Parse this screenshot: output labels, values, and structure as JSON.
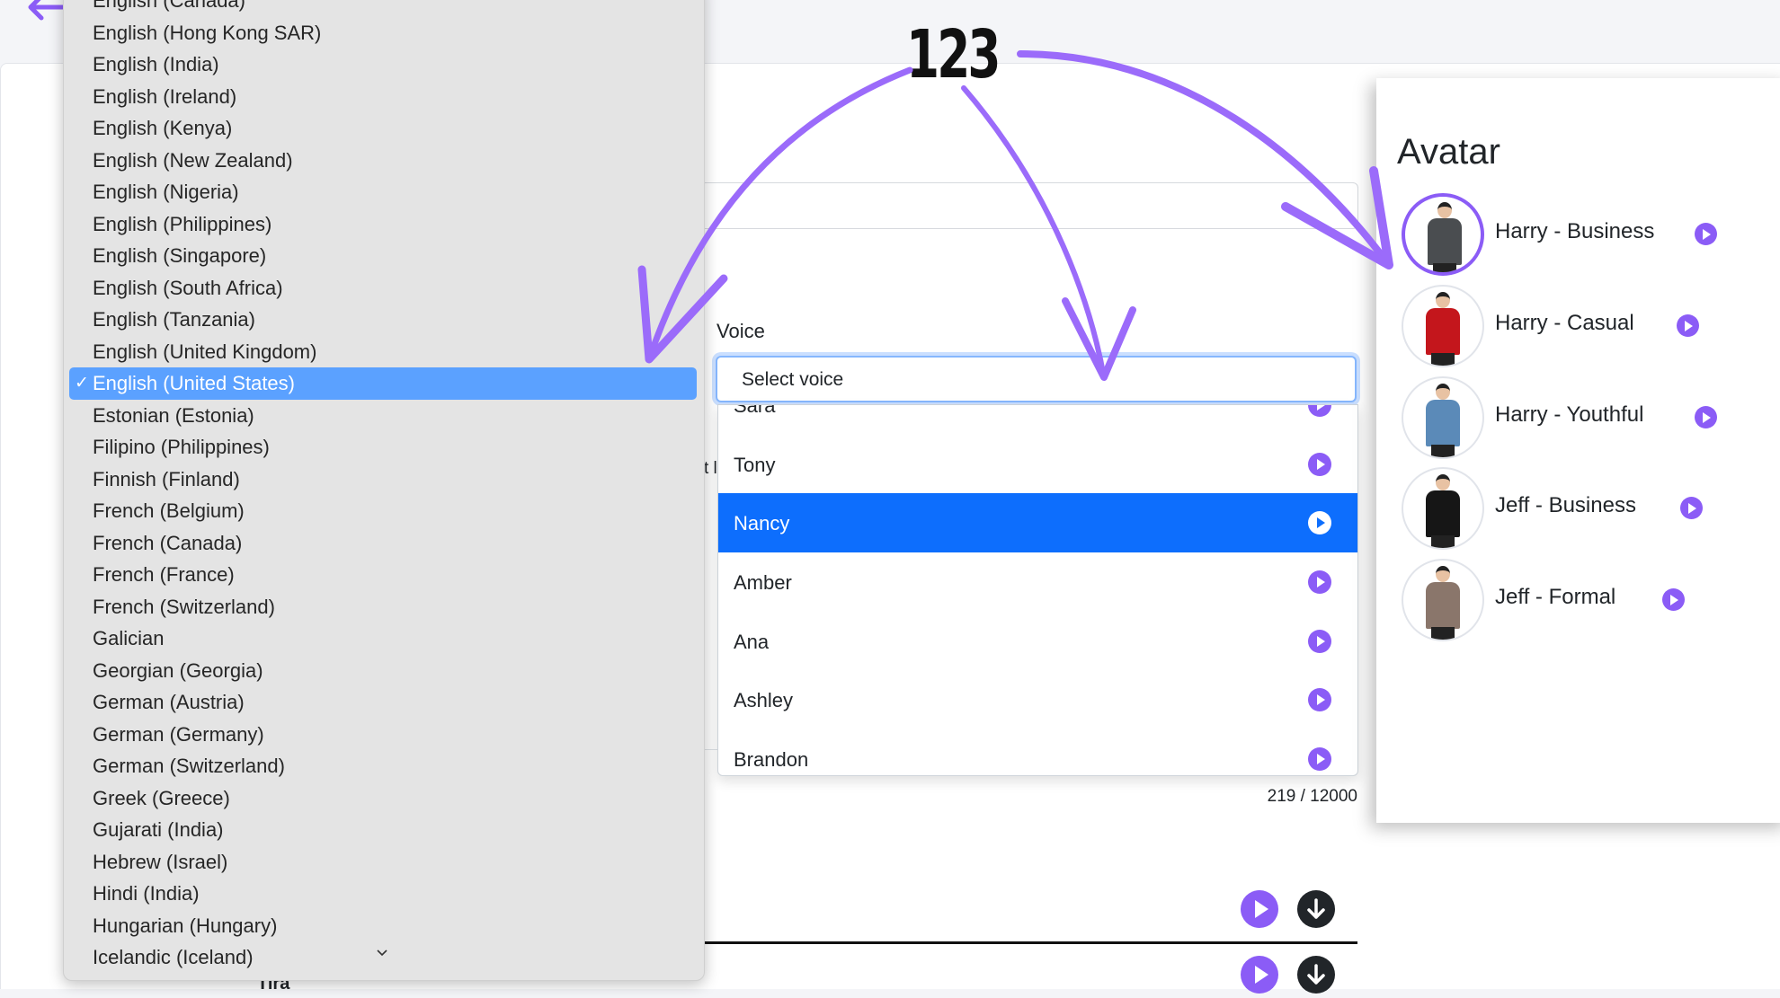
{
  "annotation": {
    "label": "123",
    "accent_color": "#9b6bfa"
  },
  "header": {
    "back_icon": "arrow-left-icon"
  },
  "language_dropdown": {
    "items": [
      "English (Canada)",
      "English (Hong Kong SAR)",
      "English (India)",
      "English (Ireland)",
      "English (Kenya)",
      "English (New Zealand)",
      "English (Nigeria)",
      "English (Philippines)",
      "English (Singapore)",
      "English (South Africa)",
      "English (Tanzania)",
      "English (United Kingdom)",
      "English (United States)",
      "Estonian (Estonia)",
      "Filipino (Philippines)",
      "Finnish (Finland)",
      "French (Belgium)",
      "French (Canada)",
      "French (France)",
      "French (Switzerland)",
      "Galician",
      "Georgian (Georgia)",
      "German (Austria)",
      "German (Germany)",
      "German (Switzerland)",
      "Greek (Greece)",
      "Gujarati (India)",
      "Hebrew (Israel)",
      "Hindi (India)",
      "Hungarian (Hungary)",
      "Icelandic (Iceland)"
    ],
    "selected": "English (United States)",
    "check_mark": "✓",
    "selected_color": "#5ba1ff"
  },
  "voice": {
    "label": "Voice",
    "placeholder": "Select voice",
    "options": [
      "Sara",
      "Tony",
      "Nancy",
      "Amber",
      "Ana",
      "Ashley",
      "Brandon"
    ],
    "highlighted": "Nancy",
    "highlight_color": "#0d6efd"
  },
  "editor": {
    "partial_text": "t l",
    "char_count": "219 / 12000",
    "bottom_partial_text": "Tira"
  },
  "avatar_panel": {
    "title": "Avatar",
    "items": [
      {
        "name": "Harry - Business",
        "outfit_color": "#4a4d50",
        "selected": true
      },
      {
        "name": "Harry - Casual",
        "outfit_color": "#c4161c",
        "selected": false
      },
      {
        "name": "Harry - Youthful",
        "outfit_color": "#5b8ab8",
        "selected": false
      },
      {
        "name": "Jeff - Business",
        "outfit_color": "#161616",
        "selected": false
      },
      {
        "name": "Jeff - Formal",
        "outfit_color": "#8a766b",
        "selected": false
      }
    ]
  }
}
